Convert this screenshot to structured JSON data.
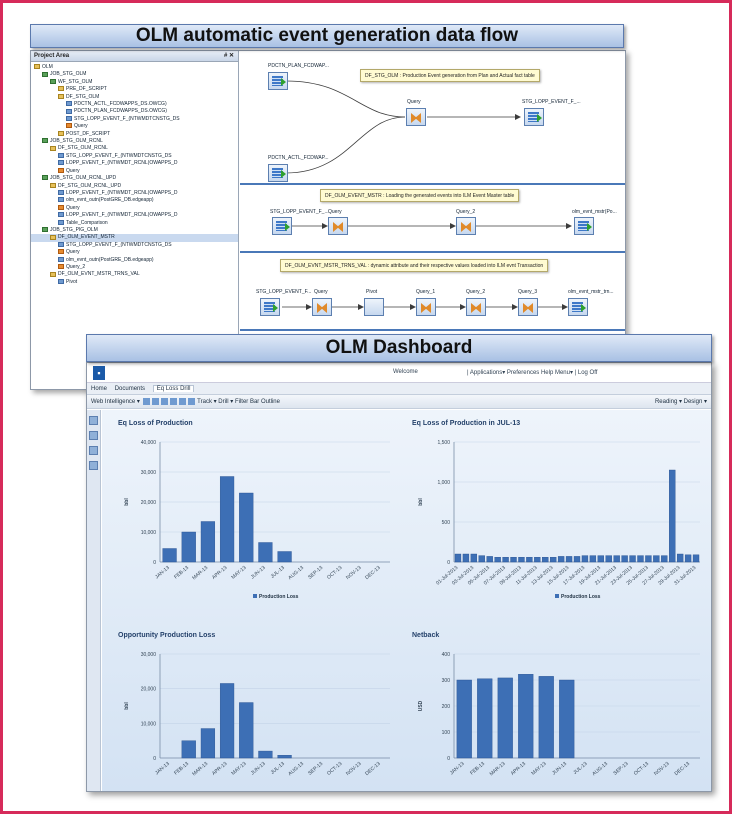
{
  "dataflow": {
    "banner": "OLM automatic event generation data flow",
    "project_area": {
      "header": "Project Area",
      "controls": "# ✕",
      "tree": [
        "OLM",
        "JOB_STG_OLM",
        "WF_STG_OLM",
        "PRE_DF_SCRIPT",
        "DF_STG_OLM",
        "PDCTN_ACTL_FCDWAPPS_DS.OWCG)",
        "PDCTN_PLAN_FCDWAPPS_DS.OWCG)",
        "STG_LOPP_EVENT_F_(NTWMDTCNSTG_DS",
        "Query",
        "POST_DF_SCRIPT",
        "JOB_STG_OLM_RCNL",
        "DF_STG_OLM_RCNL",
        "STG_LOPP_EVENT_F_(NTWMDTCNSTG_DS",
        "LOPP_EVENT_F_(NTWMDT_RCNL(OWAPPS_D",
        "Query",
        "JOB_STG_OLM_RCNL_UPD",
        "DF_STG_OLM_RCNL_UPD",
        "LOPP_EVENT_F_(NTWMDT_RCNL(OWAPPS_D",
        "olm_evnt_outn(PostGRE_DB.edgeapp)",
        "Query",
        "LOPP_EVENT_F_(NTWMDT_RCNL(OWAPPS_D",
        "Table_Comparison",
        "JOB_STG_PIG_OLM",
        "DF_OLM_EVENT_MSTR",
        "STG_LOPP_EVENT_F_(NTWMDTCNSTG_DS",
        "Query",
        "olm_evnt_outn(PostGRE_DB.edgeapp)",
        "Query_2",
        "DF_OLM_EVNT_MSTR_TRNS_VAL",
        "Pivot"
      ]
    },
    "nodes": {
      "plan": "PDCTN_PLAN_FCDWAP...",
      "actl": "PDCTN_ACTL_FCDWAP...",
      "query": "Query",
      "stg_evt": "STG_LOPP_EVENT_F_...",
      "b2_src": "STG_LOPP_EVENT_F_...",
      "b2_q1": "Query",
      "b2_q2": "Query_2",
      "b2_tgt": "olm_evnt_mstr(Po...",
      "b3_src": "STG_LOPP_EVENT_F...",
      "b3_q": "Query",
      "b3_pivot": "Pivot",
      "b3_q1": "Query_1",
      "b3_q2": "Query_2",
      "b3_q3": "Query_3",
      "b3_tgt": "olm_evnt_mstr_trn..."
    },
    "notes": {
      "n1": "DF_STG_OLM : Production Event generation from Plan and Actual fact table",
      "n2": "DF_OLM_EVENT_MSTR : Loading the generated events into ILM Event Master table",
      "n3": "DF_OLM_EVNT_MSTR_TRNS_VAL : dynamic attribute and their respective values loaded into ILM evnt Transaction"
    }
  },
  "dashboard": {
    "banner": "OLM Dashboard",
    "welcome": "Welcome",
    "menu": "| Applications▾  Preferences  Help Menu▾  |  Log Off",
    "tabs": [
      "Home",
      "Documents",
      "Eq Loss Drill"
    ],
    "toolbar_left": "Web Intelligence ▾",
    "toolbar_items": "Track ▾  Drill ▾  Filter Bar  Outline",
    "toolbar_right": "Reading ▾  Design ▾"
  },
  "chart_data": [
    {
      "type": "bar",
      "title": "Eq Loss of Production",
      "ylabel": "bbl",
      "legend": "Production Loss",
      "ylim": [
        0,
        40000
      ],
      "yticks": [
        "0",
        "10,000",
        "20,000",
        "30,000",
        "40,000"
      ],
      "categories": [
        "JAN-13",
        "FEB-13",
        "MAR-13",
        "APR-13",
        "MAY-13",
        "JUN-13",
        "JUL-13",
        "AUG-13",
        "SEP-13",
        "OCT-13",
        "NOV-13",
        "DEC-13"
      ],
      "values": [
        4500,
        10000,
        13500,
        28500,
        23000,
        6500,
        3500,
        0,
        0,
        0,
        0,
        0
      ],
      "color": "#3d6fb5"
    },
    {
      "type": "bar",
      "title": "Eq Loss of Production in JUL-13",
      "ylabel": "bbl",
      "legend": "Production Loss",
      "ylim": [
        0,
        1500
      ],
      "yticks": [
        "0",
        "500",
        "1,000",
        "1,500"
      ],
      "categories": [
        "01-Jul-2013",
        "02-Jul-2013",
        "03-Jul-2013",
        "04-Jul-2013",
        "05-Jul-2013",
        "06-Jul-2013",
        "07-Jul-2013",
        "08-Jul-2013",
        "09-Jul-2013",
        "10-Jul-2013",
        "11-Jul-2013",
        "12-Jul-2013",
        "13-Jul-2013",
        "14-Jul-2013",
        "15-Jul-2013",
        "16-Jul-2013",
        "17-Jul-2013",
        "18-Jul-2013",
        "19-Jul-2013",
        "20-Jul-2013",
        "21-Jul-2013",
        "22-Jul-2013",
        "23-Jul-2013",
        "24-Jul-2013",
        "25-Jul-2013",
        "26-Jul-2013",
        "27-Jul-2013",
        "28-Jul-2013",
        "29-Jul-2013",
        "30-Jul-2013",
        "31-Jul-2013"
      ],
      "tick_labels": [
        "01-Jul-2013",
        "03-Jul-2013",
        "05-Jul-2013",
        "07-Jul-2013",
        "09-Jul-2013",
        "11-Jul-2013",
        "13-Jul-2013",
        "15-Jul-2013",
        "17-Jul-2013",
        "19-Jul-2013",
        "21-Jul-2013",
        "23-Jul-2013",
        "25-Jul-2013",
        "27-Jul-2013",
        "29-Jul-2013",
        "31-Jul-2013"
      ],
      "values": [
        100,
        100,
        100,
        80,
        70,
        60,
        60,
        60,
        60,
        60,
        60,
        60,
        60,
        70,
        70,
        70,
        80,
        80,
        80,
        80,
        80,
        80,
        80,
        80,
        80,
        80,
        80,
        1150,
        100,
        90,
        90
      ],
      "color": "#3d6fb5"
    },
    {
      "type": "bar",
      "title": "Opportunity Production Loss",
      "ylabel": "bbl",
      "legend": "",
      "ylim": [
        0,
        30000
      ],
      "yticks": [
        "0",
        "10,000",
        "20,000",
        "30,000"
      ],
      "categories": [
        "JAN-13",
        "FEB-13",
        "MAR-13",
        "APR-13",
        "MAY-13",
        "JUN-13",
        "JUL-13",
        "AUG-13",
        "SEP-13",
        "OCT-13",
        "NOV-13",
        "DEC-13"
      ],
      "values": [
        0,
        5000,
        8500,
        21500,
        16000,
        2000,
        800,
        0,
        0,
        0,
        0,
        0
      ],
      "color": "#3d6fb5"
    },
    {
      "type": "bar",
      "title": "Netback",
      "ylabel": "USD",
      "legend": "",
      "ylim": [
        0,
        400
      ],
      "yticks": [
        "0",
        "100",
        "200",
        "300",
        "400"
      ],
      "categories": [
        "JAN-13",
        "FEB-13",
        "MAR-13",
        "APR-13",
        "MAY-13",
        "JUN-13",
        "JUL-13",
        "AUG-13",
        "SEP-13",
        "OCT-13",
        "NOV-13",
        "DEC-13"
      ],
      "values": [
        300,
        305,
        308,
        322,
        314,
        300,
        0,
        0,
        0,
        0,
        0,
        0
      ],
      "color": "#3d6fb5"
    }
  ]
}
